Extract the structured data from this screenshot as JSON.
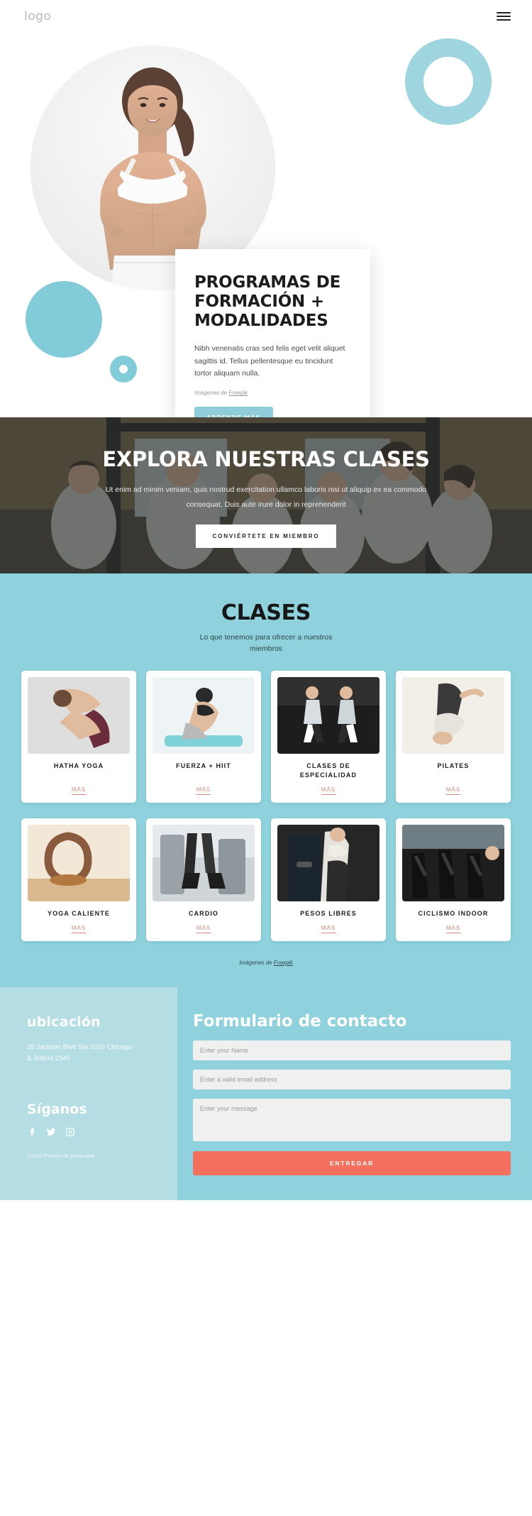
{
  "header": {
    "logo": "logo",
    "menu_icon": "hamburger-menu-icon"
  },
  "hero": {
    "title": "PROGRAMAS DE FORMACIÓN + MODALIDADES",
    "paragraph": "Nibh venenatis cras sed felis eget velit aliquet sagittis id. Tellus pellentesque eu tincidunt tortor aliquam nulla.",
    "credit_prefix": "Imágenes de ",
    "credit_link": "Freepik",
    "cta_label": "APRENDE MÁS"
  },
  "banner": {
    "title": "EXPLORA NUESTRAS CLASES",
    "paragraph": "Ut enim ad minim veniam, quis nostrud exercitation ullamco laboris nisi ut aliquip ex ea commodo consequat. Duis aute irure dolor in reprehenderit",
    "cta_label": "CONVIÉRTETE EN MIEMBRO"
  },
  "classes": {
    "title": "CLASES",
    "subtitle": "Lo que tenemos para ofrecer a nuestros miembros",
    "more_label": "MÁS",
    "credit_prefix": "Imágenes de ",
    "credit_link": "Freepik",
    "items": [
      {
        "name": "HATHA YOGA"
      },
      {
        "name": "FUERZA + HIIT"
      },
      {
        "name": "CLASES DE ESPECIALIDAD"
      },
      {
        "name": "PILATES"
      },
      {
        "name": "YOGA CALIENTE"
      },
      {
        "name": "CARDIO"
      },
      {
        "name": "PESOS LIBRES"
      },
      {
        "name": "CICLISMO INDOOR"
      }
    ]
  },
  "footer": {
    "location_heading": "ubicación",
    "address_line1": "28 Jackson Blvd Ste 1020 Chicago",
    "address_line2": "IL 60604-2340",
    "follow_heading": "Síganos",
    "socials": [
      "facebook-icon",
      "twitter-icon",
      "instagram-icon"
    ],
    "copyright": "©2022 Política de privacidad",
    "form_title": "Formulario de contacto",
    "name_placeholder": "Enter your Name",
    "email_placeholder": "Enter a valid email address",
    "message_placeholder": "Enter your message",
    "submit_label": "ENTREGAR"
  },
  "colors": {
    "aqua": "#8fd2dd",
    "aqua_light": "#b4dde4",
    "coral": "#f4705e",
    "more_link": "#d58a7a"
  }
}
